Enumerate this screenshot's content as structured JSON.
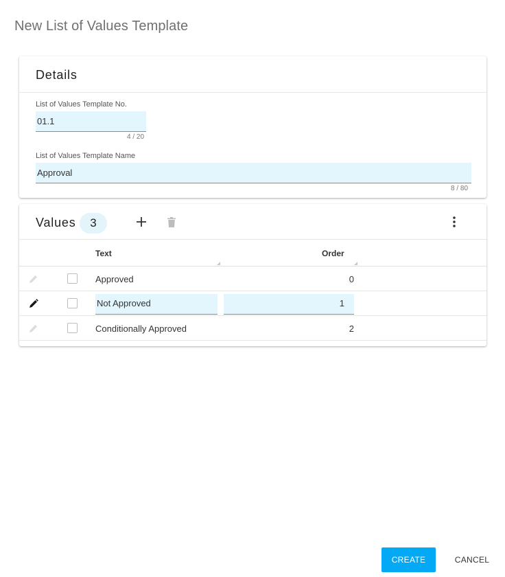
{
  "dialog": {
    "title": "New List of Values Template"
  },
  "details": {
    "title": "Details",
    "template_no": {
      "label": "List of Values Template No.",
      "value": "01.1",
      "counter": "4 / 20"
    },
    "template_name": {
      "label": "List of Values Template Name",
      "value": "Approval",
      "counter": "8 / 80"
    }
  },
  "values": {
    "title": "Values",
    "count": "3",
    "icons": {
      "add": "plus-icon",
      "delete": "trash-icon",
      "more": "more-vert-icon",
      "edit": "pencil-icon"
    },
    "columns": [
      "Text",
      "Order"
    ],
    "rows": [
      {
        "text": "Approved",
        "order": "0",
        "editing": false
      },
      {
        "text": "Not Approved",
        "order": "1",
        "editing": true
      },
      {
        "text": "Conditionally Approved",
        "order": "2",
        "editing": false
      }
    ]
  },
  "actions": {
    "create": "CREATE",
    "cancel": "CANCEL"
  },
  "colors": {
    "accent": "#03a9f4",
    "field_bg": "#e3f6fd",
    "badge_bg": "#e3f4fb"
  }
}
